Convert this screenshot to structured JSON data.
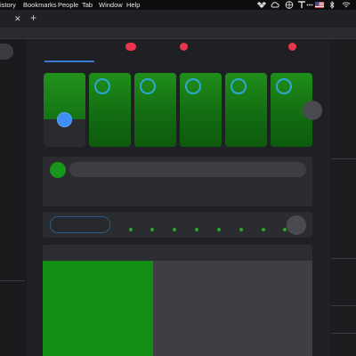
{
  "menubar": {
    "items": [
      "istory",
      "Bookmarks",
      "People",
      "Tab",
      "Window",
      "Help"
    ],
    "icons": [
      "dropbox-icon",
      "cloud-icon",
      "globe-icon",
      "text-icon",
      "ellipsis-icon",
      "flag-icon",
      "bluetooth-icon",
      "wifi-icon"
    ]
  },
  "tabstrip": {
    "close_glyph": "✕",
    "newtab_glyph": "+"
  },
  "colors": {
    "accent_green": "#138e12",
    "accent_blue": "#3b79d8",
    "alert_red": "#e8354b",
    "ring_blue": "#2fa8d8"
  },
  "cards": {
    "count": 6,
    "first_fill_fraction": 0.63
  },
  "dots": {
    "count": 8
  }
}
